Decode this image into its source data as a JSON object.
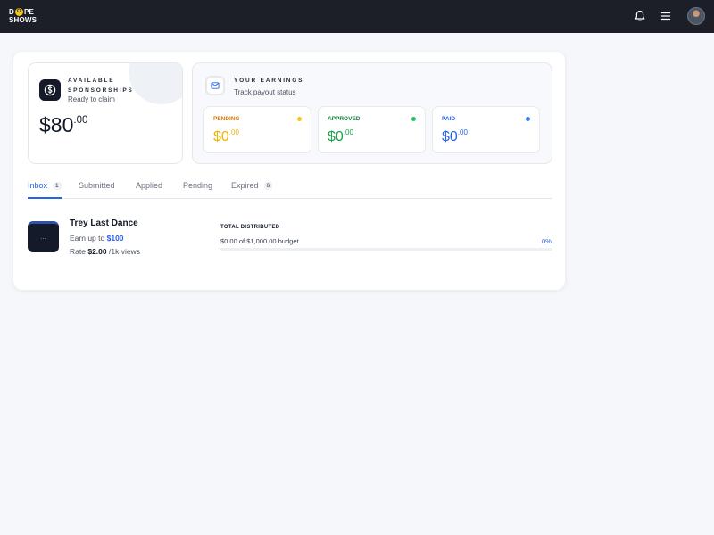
{
  "brand": {
    "line1_left": "D",
    "line1_o": "O",
    "line1_right": "PE",
    "line2": "SHOWS"
  },
  "header": {
    "icons": [
      "bell-icon",
      "menu-icon",
      "avatar"
    ]
  },
  "sponsorships": {
    "kicker": "AVAILABLE SPONSORSHIPS",
    "subtitle": "Ready to claim",
    "amount_main": "$80",
    "amount_cents": ".00"
  },
  "earnings": {
    "kicker": "YOUR EARNINGS",
    "subtitle": "Track payout status",
    "cards": [
      {
        "label": "PENDING",
        "value_main": "$0",
        "value_cents": ".00",
        "color": "#f59e0b",
        "dot": "#f5c518"
      },
      {
        "label": "APPROVED",
        "value_main": "$0",
        "value_cents": ".00",
        "color": "#16a34a",
        "dot": "#22c55e"
      },
      {
        "label": "PAID",
        "value_main": "$0",
        "value_cents": ".00",
        "color": "#2563eb",
        "dot": "#3b82f6"
      }
    ]
  },
  "tabs": [
    {
      "label": "Inbox",
      "count": "1",
      "active": true
    },
    {
      "label": "Submitted"
    },
    {
      "label": "Applied"
    },
    {
      "label": "Pending"
    },
    {
      "label": "Expired",
      "count": "6"
    }
  ],
  "item": {
    "thumb": "...",
    "title": "Trey Last Dance",
    "earn_prefix": "Earn up to",
    "earn_amount": "$100",
    "rate_prefix": "Rate",
    "rate_value": "$2.00",
    "rate_suffix": "/1k views"
  },
  "distribution": {
    "label": "TOTAL DISTRIBUTED",
    "summary": "$0.00 of $1,000.00 budget",
    "percent": "0%",
    "progress": 0
  }
}
